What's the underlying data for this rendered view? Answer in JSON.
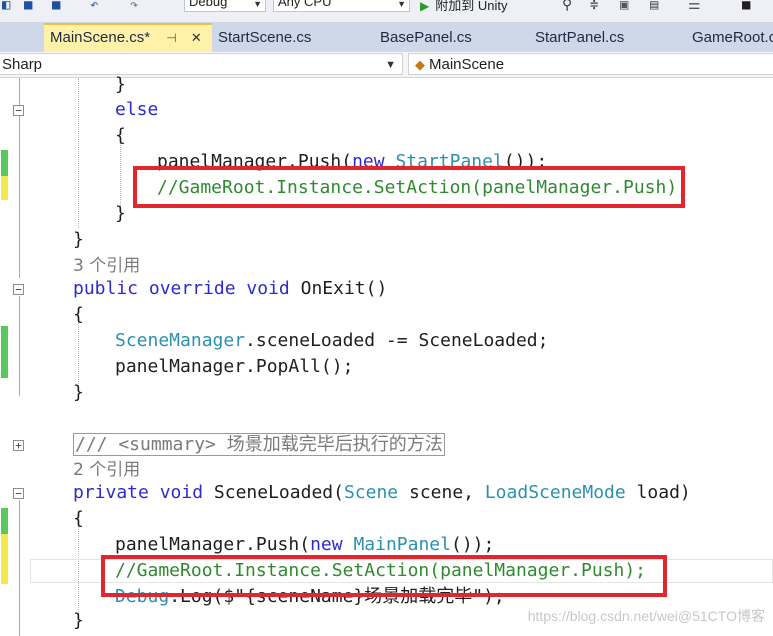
{
  "toolbar": {
    "config_value": "Debug",
    "platform_value": "Any CPU",
    "run_label": "附加到 Unity"
  },
  "tabs": [
    {
      "label": "MainScene.cs*",
      "pin": "⊣",
      "close": "✕"
    },
    {
      "label": "StartScene.cs"
    },
    {
      "label": "BasePanel.cs"
    },
    {
      "label": "StartPanel.cs"
    },
    {
      "label": "GameRoot.c"
    }
  ],
  "nav": {
    "project": "Sharp",
    "class": "MainScene"
  },
  "code": {
    "l0": "}",
    "l1_else": "else",
    "l2": "{",
    "l3_a": "panelManager.Push(",
    "l3_new": "new",
    "l3_type": "StartPanel",
    "l3_b": "());",
    "l4": "//GameRoot.Instance.SetAction(panelManager.Push);",
    "l5": "}",
    "l6": "}",
    "l7_ref": "3 个引用",
    "l8_public": "public",
    "l8_override": "override",
    "l8_void": "void",
    "l8_rest": "OnExit()",
    "l9": "{",
    "l10_type": "SceneManager",
    "l10_rest": ".sceneLoaded -= SceneLoaded;",
    "l11": "panelManager.PopAll();",
    "l12": "}",
    "l14_summary": "/// <summary> 场景加载完毕后执行的方法",
    "l15_ref": "2 个引用",
    "l16_private": "private",
    "l16_void": "void",
    "l16_name": "SceneLoaded(",
    "l16_scene_type": "Scene",
    "l16_scene": " scene, ",
    "l16_mode_type": "LoadSceneMode",
    "l16_load": " load)",
    "l17": "{",
    "l18_a": "panelManager.Push(",
    "l18_new": "new",
    "l18_type": "MainPanel",
    "l18_b": "());",
    "l19": "//GameRoot.Instance.SetAction(panelManager.Push);",
    "l20_type": "Debug",
    "l20_rest": ".Log($\"{sceneName}场景加载完毕\");",
    "l21": "}"
  },
  "watermark": "https://blog.csdn.net/wei@51CTO博客",
  "colors": {
    "keyword": "#2b2bd0",
    "type": "#2b91af",
    "comment": "#2f8a2f",
    "highlight_box": "#e2262e",
    "active_tab": "#fff2a8"
  }
}
